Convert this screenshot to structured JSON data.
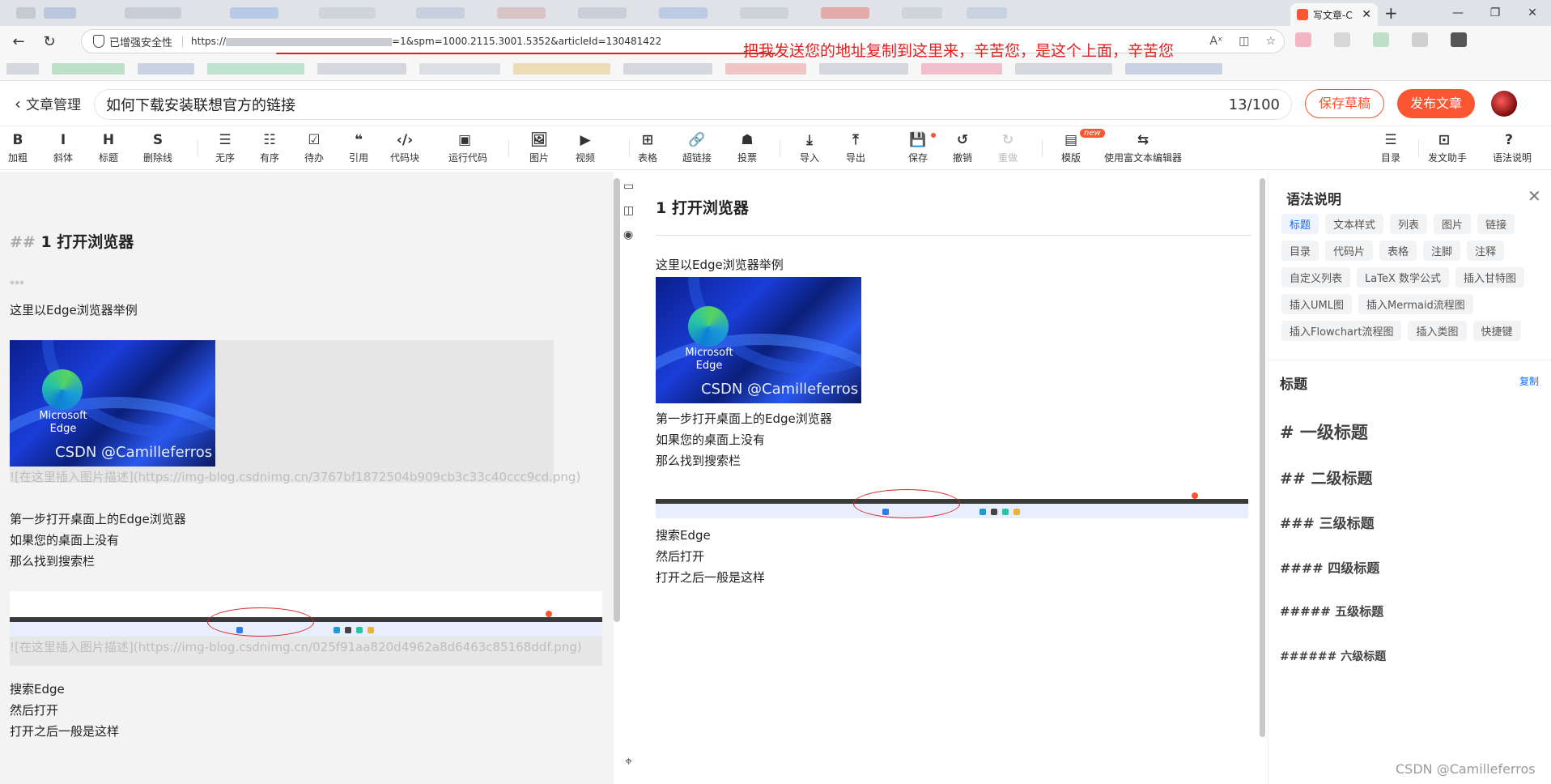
{
  "browser": {
    "active_tab_title": "写文章-C",
    "tab_close": "✕",
    "new_tab": "+",
    "window_controls": [
      "—",
      "❐",
      "✕"
    ],
    "security_label": "已增强安全性",
    "url_prefix": "https://",
    "url_suffix": "=1&spm=1000.2115.3001.5352&articleId=130481422",
    "annotation_text": "把我发送您的地址复制到这里来，辛苦您，是这个上面，辛苦您"
  },
  "article_header": {
    "back_label": "文章管理",
    "title_value": "如何下载安装联想官方的链接",
    "char_count": "13/100",
    "save_draft_label": "保存草稿",
    "publish_label": "发布文章"
  },
  "toolbar": {
    "items": [
      {
        "icon": "B",
        "label": "加粗"
      },
      {
        "icon": "I",
        "label": "斜体"
      },
      {
        "icon": "H",
        "label": "标题"
      },
      {
        "icon": "S",
        "label": "删除线"
      },
      {
        "icon": "☰",
        "label": "无序"
      },
      {
        "icon": "☷",
        "label": "有序"
      },
      {
        "icon": "☑",
        "label": "待办"
      },
      {
        "icon": "❝",
        "label": "引用"
      },
      {
        "icon": "‹/›",
        "label": "代码块"
      },
      {
        "icon": "▣",
        "label": "运行代码"
      },
      {
        "icon": "🖼",
        "label": "图片"
      },
      {
        "icon": "▶",
        "label": "视频"
      },
      {
        "icon": "⊞",
        "label": "表格"
      },
      {
        "icon": "🔗",
        "label": "超链接"
      },
      {
        "icon": "☗",
        "label": "投票"
      },
      {
        "icon": "⤓",
        "label": "导入"
      },
      {
        "icon": "⤒",
        "label": "导出"
      },
      {
        "icon": "💾",
        "label": "保存"
      },
      {
        "icon": "↺",
        "label": "撤销"
      },
      {
        "icon": "↻",
        "label": "重做"
      },
      {
        "icon": "▤",
        "label": "模版"
      },
      {
        "icon": "⇆",
        "label": "使用富文本编辑器"
      },
      {
        "icon": "☰",
        "label": "目录"
      },
      {
        "icon": "⊡",
        "label": "发文助手"
      },
      {
        "icon": "?",
        "label": "语法说明"
      }
    ],
    "new_badge": "new"
  },
  "editor": {
    "dim_marker_1": "***",
    "heading_hashes": "##",
    "heading_text": "1 打开浏览器",
    "dim_marker_2": "***",
    "line_intro": "这里以Edge浏览器举例",
    "img1_link": "![在这里插入图片描述](https://img-blog.csdnimg.cn/3767bf1872504b909cb3c33c40ccc9cd.png)",
    "line_step1": "第一步打开桌面上的Edge浏览器",
    "line_step2": "如果您的桌面上没有",
    "line_step3": "那么找到搜索栏",
    "img2_link": "![在这里插入图片描述](https://img-blog.csdnimg.cn/025f91aa820d4962a8d6463c85168ddf.png)",
    "line_search": "搜索Edge",
    "line_open": "然后打开",
    "line_after": "打开之后一般是这样"
  },
  "image": {
    "edge_label_1": "Microsoft",
    "edge_label_2": "Edge",
    "inner_watermark": "CSDN @Camilleferros"
  },
  "preview": {
    "heading": "1 打开浏览器",
    "line_intro": "这里以Edge浏览器举例",
    "line_step1": "第一步打开桌面上的Edge浏览器",
    "line_step2": "如果您的桌面上没有",
    "line_step3": "那么找到搜索栏",
    "line_search": "搜索Edge",
    "line_open": "然后打开",
    "line_after": "打开之后一般是这样"
  },
  "help": {
    "title": "语法说明",
    "close": "✕",
    "chips": [
      "标题",
      "文本样式",
      "列表",
      "图片",
      "链接",
      "目录",
      "代码片",
      "表格",
      "注脚",
      "注释",
      "自定义列表",
      "LaTeX 数学公式",
      "插入甘特图",
      "插入UML图",
      "插入Mermaid流程图",
      "插入Flowchart流程图",
      "插入类图",
      "快捷键"
    ],
    "section_title": "标题",
    "copy_label": "复制",
    "headings": [
      "# 一级标题",
      "## 二级标题",
      "### 三级标题",
      "#### 四级标题",
      "##### 五级标题",
      "###### 六级标题"
    ]
  },
  "page_watermark": "CSDN @Camilleferros",
  "colors": {
    "accent": "#fc5531",
    "annotation": "#e02020",
    "link_blue": "#0a6cff"
  }
}
